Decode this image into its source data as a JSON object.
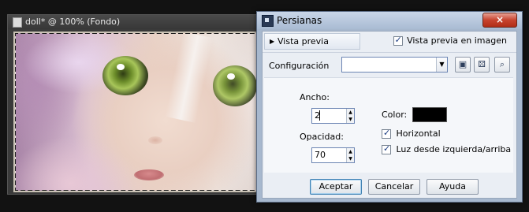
{
  "image_window": {
    "title": "doll* @ 100% (Fondo)"
  },
  "dialog": {
    "title": "Persianas",
    "close_label": "×",
    "preview_toggle_label": "Vista previa",
    "preview_checkbox_label": "Vista previa en imagen",
    "preview_checked": true,
    "config_label": "Configuración",
    "config_value": "",
    "fields": {
      "ancho_label": "Ancho:",
      "ancho_value": "2",
      "opacidad_label": "Opacidad:",
      "opacidad_value": "70",
      "color_label": "Color:",
      "color_value": "#000000",
      "horizontal_label": "Horizontal",
      "horizontal_checked": true,
      "luz_label": "Luz desde izquierda/arriba",
      "luz_checked": true
    },
    "buttons": {
      "accept": "Aceptar",
      "cancel": "Cancelar",
      "help": "Ayuda"
    }
  }
}
